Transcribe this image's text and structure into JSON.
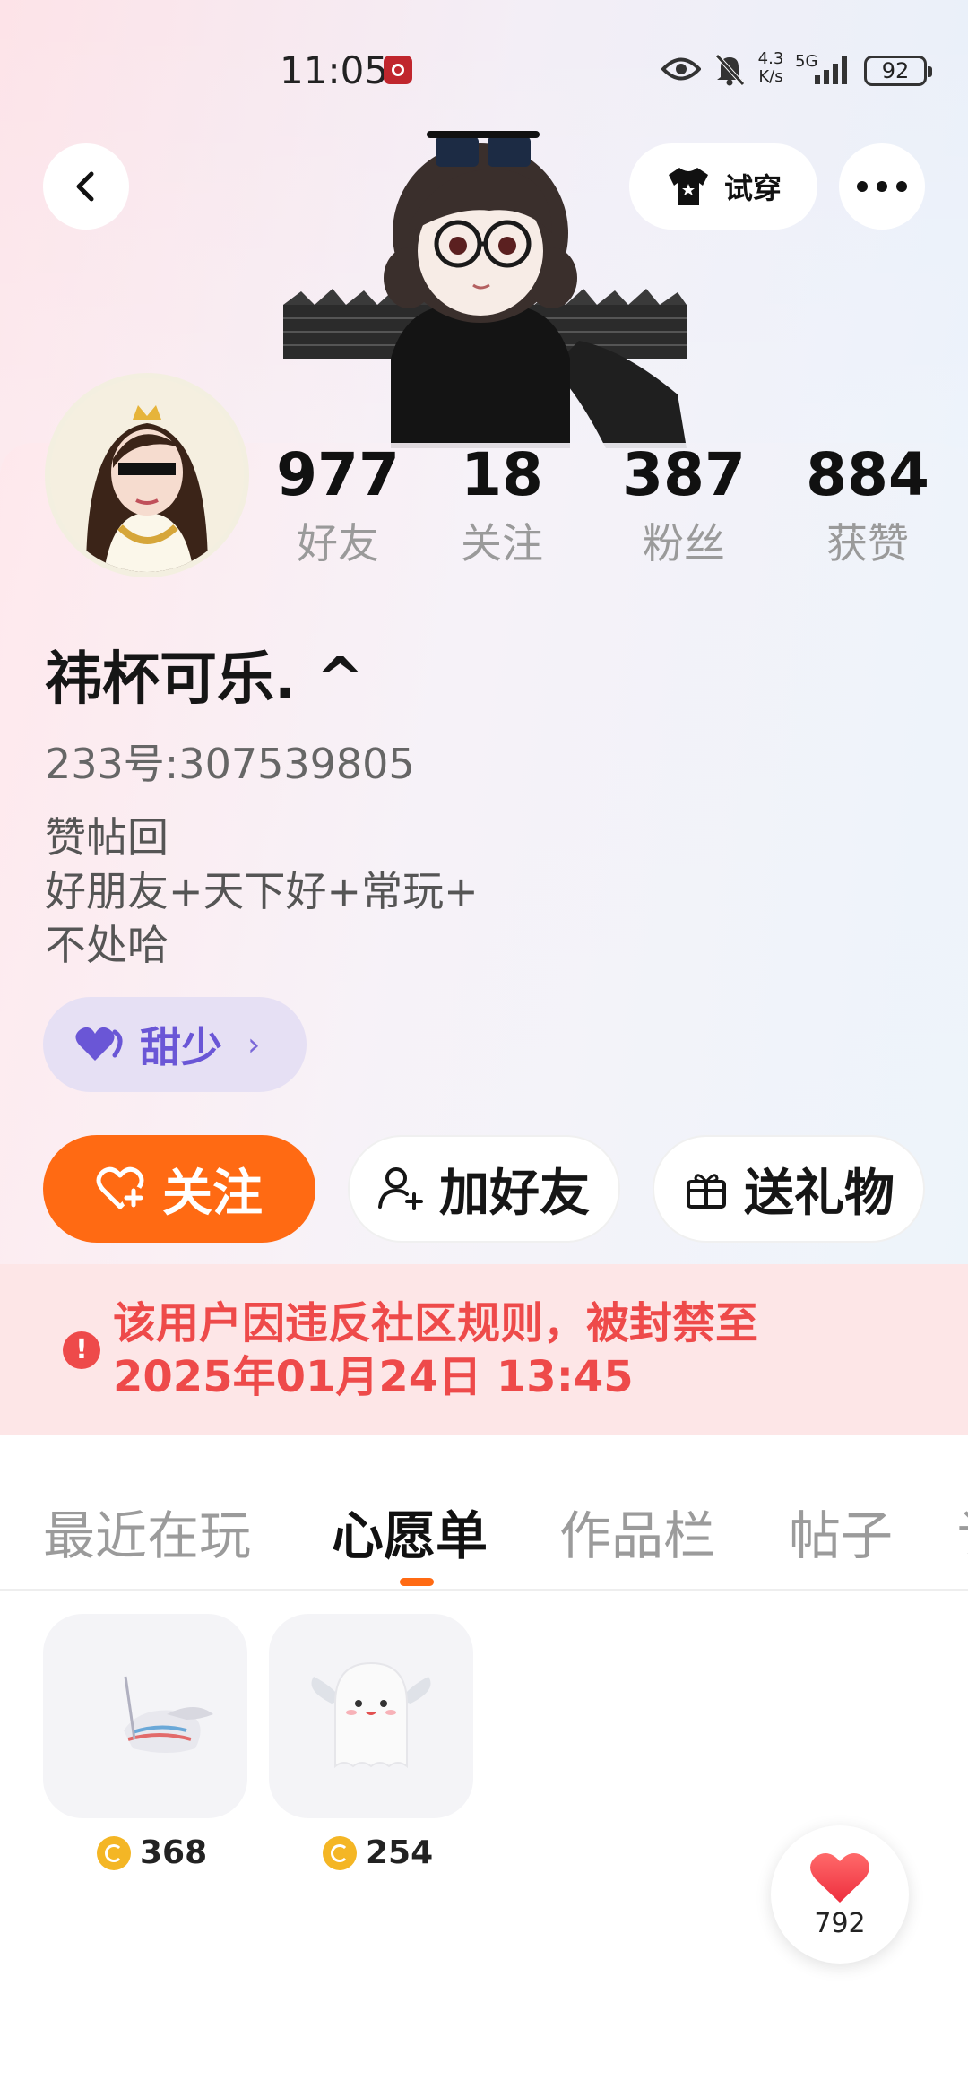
{
  "status_bar": {
    "time": "11:05",
    "net_speed_value": "4.3",
    "net_speed_unit": "K/s",
    "network": "5G",
    "battery": "92"
  },
  "header": {
    "try_on_label": "试穿"
  },
  "profile": {
    "stats": [
      {
        "value": "977",
        "label": "好友"
      },
      {
        "value": "18",
        "label": "关注"
      },
      {
        "value": "387",
        "label": "粉丝"
      },
      {
        "value": "884",
        "label": "获赞"
      }
    ],
    "nickname": "祎杯可乐. ^",
    "uid": "233号:307539805",
    "bio": [
      "赞帖回",
      "好朋友+天下好+常玩+",
      "不处哈"
    ],
    "tag": "甜少"
  },
  "actions": {
    "follow": "关注",
    "add_friend": "加好友",
    "send_gift": "送礼物"
  },
  "ban_notice": {
    "line1": "该用户因违反社区规则，被封禁至",
    "line2": "2025年01月24日 13:45"
  },
  "tabs": [
    {
      "label": "最近在玩",
      "active": false
    },
    {
      "label": "心愿单",
      "active": true
    },
    {
      "label": "作品栏",
      "active": false
    },
    {
      "label": "帖子",
      "active": false
    },
    {
      "label": "讠",
      "active": false
    }
  ],
  "wishlist": [
    {
      "price": "368",
      "icon": "wing-shoe-item"
    },
    {
      "price": "254",
      "icon": "angel-ghost-item"
    }
  ],
  "like_fab": {
    "count": "792"
  },
  "colors": {
    "accent": "#ff6a13",
    "ban_text": "#ee4a4a",
    "ban_bg": "#fde6e7",
    "tag_text": "#6a56d6",
    "tag_bg": "#e6e0f4"
  }
}
